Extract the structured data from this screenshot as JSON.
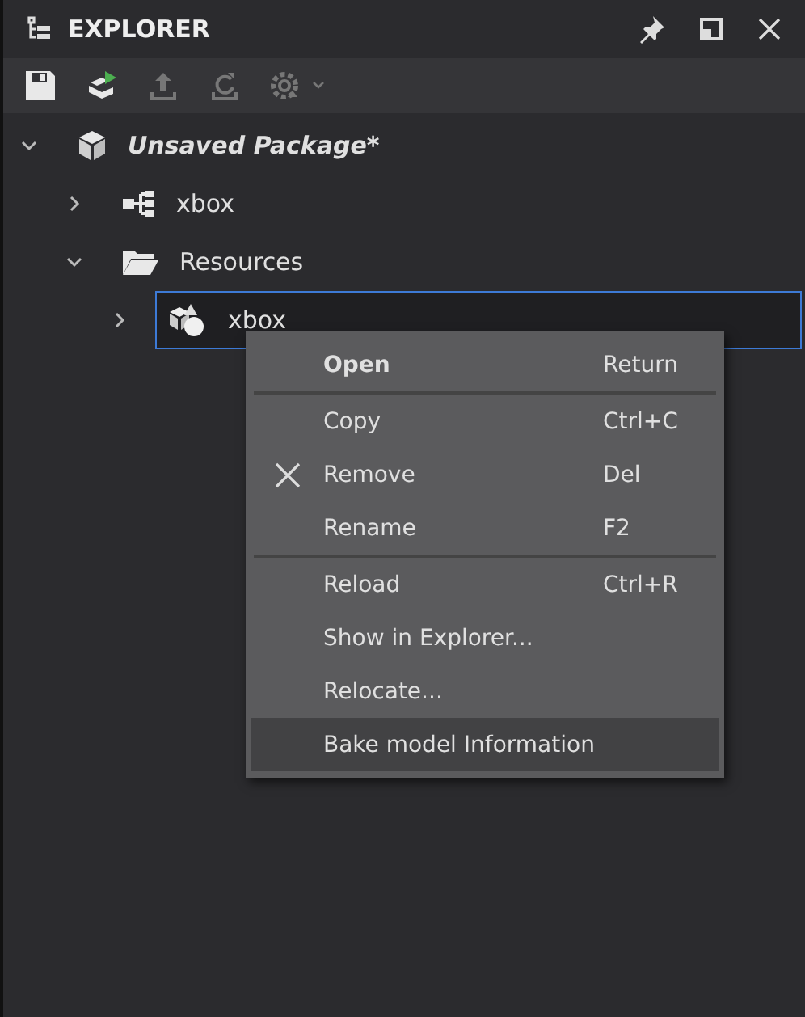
{
  "panel": {
    "title": "EXPLORER"
  },
  "toolbar": [
    {
      "kind": "save",
      "disabled": false
    },
    {
      "kind": "publish",
      "disabled": false
    },
    {
      "kind": "upload",
      "disabled": true
    },
    {
      "kind": "refresh",
      "disabled": true
    },
    {
      "kind": "bake",
      "disabled": true,
      "dropdown": true
    }
  ],
  "tree": [
    {
      "label": "Unsaved Package*",
      "kind": "package",
      "expanded": true,
      "selected": false,
      "children": [
        {
          "label": "xbox",
          "kind": "skeleton",
          "expanded": false,
          "selected": false
        },
        {
          "label": "Resources",
          "kind": "folder",
          "expanded": true,
          "selected": false,
          "children": [
            {
              "label": "xbox",
              "kind": "model",
              "expanded": false,
              "selected": true
            }
          ]
        }
      ]
    }
  ],
  "context_menu": {
    "groups": [
      [
        {
          "label": "Open",
          "shortcut": "Return",
          "default": true,
          "selected": false
        }
      ],
      [
        {
          "label": "Copy",
          "shortcut": "Ctrl+C",
          "default": false,
          "selected": false
        },
        {
          "label": "Remove",
          "shortcut": "Del",
          "kind": "remove",
          "default": false,
          "selected": false
        },
        {
          "label": "Rename",
          "shortcut": "F2",
          "default": false,
          "selected": false
        }
      ],
      [
        {
          "label": "Reload",
          "shortcut": "Ctrl+R",
          "default": false,
          "selected": false
        },
        {
          "label": "Show in Explorer...",
          "default": false,
          "selected": false
        },
        {
          "label": "Relocate...",
          "default": false,
          "selected": false
        },
        {
          "label": "Bake model Information",
          "default": false,
          "selected": true
        }
      ]
    ]
  }
}
